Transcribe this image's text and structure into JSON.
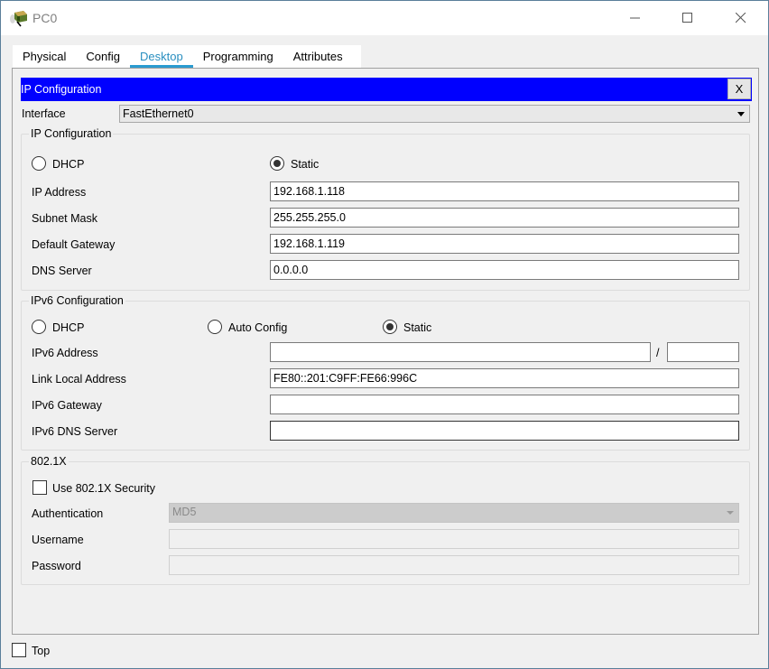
{
  "window": {
    "title": "PC0",
    "icon": "packet-tracer-pc-icon",
    "controls": [
      "minimize",
      "maximize",
      "close"
    ]
  },
  "tabs": [
    {
      "label": "Physical",
      "active": false
    },
    {
      "label": "Config",
      "active": false
    },
    {
      "label": "Desktop",
      "active": true
    },
    {
      "label": "Programming",
      "active": false
    },
    {
      "label": "Attributes",
      "active": false
    }
  ],
  "ip_config": {
    "header_title": "IP Configuration",
    "close_label": "X",
    "interface_label": "Interface",
    "interface_value": "FastEthernet0",
    "ipv4": {
      "group_title": "IP Configuration",
      "dhcp_label": "DHCP",
      "static_label": "Static",
      "mode": "Static",
      "ip_address_label": "IP Address",
      "ip_address": "192.168.1.118",
      "subnet_mask_label": "Subnet Mask",
      "subnet_mask": "255.255.255.0",
      "default_gateway_label": "Default Gateway",
      "default_gateway": "192.168.1.119",
      "dns_server_label": "DNS Server",
      "dns_server": "0.0.0.0"
    },
    "ipv6": {
      "group_title": "IPv6 Configuration",
      "dhcp_label": "DHCP",
      "auto_config_label": "Auto Config",
      "static_label": "Static",
      "mode": "Static",
      "address_label": "IPv6 Address",
      "address": "",
      "prefix_separator": "/",
      "prefix": "",
      "link_local_label": "Link Local Address",
      "link_local": "FE80::201:C9FF:FE66:996C",
      "gateway_label": "IPv6 Gateway",
      "gateway": "",
      "dns_server_label": "IPv6 DNS Server",
      "dns_server": ""
    },
    "dot1x": {
      "group_title": "802.1X",
      "use_security_label": "Use 802.1X Security",
      "use_security_checked": false,
      "authentication_label": "Authentication",
      "authentication_value": "MD5",
      "username_label": "Username",
      "username": "",
      "password_label": "Password",
      "password": ""
    }
  },
  "footer": {
    "top_label": "Top",
    "top_checked": false
  }
}
